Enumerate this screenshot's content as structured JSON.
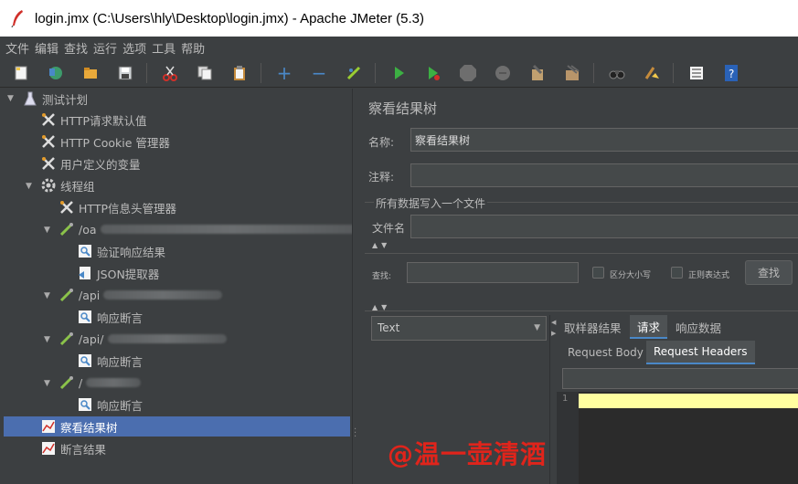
{
  "window": {
    "title": "login.jmx (C:\\Users\\hly\\Desktop\\login.jmx) - Apache JMeter (5.3)"
  },
  "menu": [
    "文件",
    "编辑",
    "查找",
    "运行",
    "选项",
    "工具",
    "帮助"
  ],
  "toolbar": {
    "icons": [
      "new-icon",
      "templates-icon",
      "open-icon",
      "save-icon",
      "cut-icon",
      "copy-icon",
      "paste-icon",
      "expand-icon",
      "collapse-icon",
      "toggle-icon",
      "start-icon",
      "start-no-pause-icon",
      "stop-icon",
      "shutdown-icon",
      "clear-icon",
      "clear-all-icon",
      "search-icon",
      "reset-search-icon",
      "function-helper-icon",
      "help-icon"
    ]
  },
  "tree": {
    "root": "测试计划",
    "http_defaults": "HTTP请求默认值",
    "cookie_manager": "HTTP Cookie 管理器",
    "user_vars": "用户定义的变量",
    "thread_group": "线程组",
    "header_manager": "HTTP信息头管理器",
    "sampler1": "/oa",
    "assertion1": "验证响应结果",
    "json_extractor": "JSON提取器",
    "sampler2": "/api",
    "assertion2": "响应断言",
    "sampler3": "/api/",
    "assertion3": "响应断言",
    "sampler4": "/",
    "assertion4": "响应断言",
    "result_tree": "察看结果树",
    "assert_results": "断言结果"
  },
  "panel": {
    "title": "察看结果树",
    "name_label": "名称:",
    "name_value": "察看结果树",
    "comment_label": "注释:",
    "comment_value": "",
    "file_section": "所有数据写入一个文件",
    "filename_label": "文件名",
    "search_label": "查找:",
    "case_label": "区分大小写",
    "regex_label": "正则表达式",
    "search_button": "查找",
    "renderer": "Text",
    "tabs": [
      "取样器结果",
      "请求",
      "响应数据"
    ],
    "subtabs": [
      "Request Body",
      "Request Headers"
    ],
    "line_number": "1"
  },
  "watermark": "@温一壶清酒",
  "colors": {
    "selected": "#4b6eaf",
    "accent_tab": "#4a88c7",
    "editor_line": "#ffffa0",
    "watermark": "#e0241b"
  }
}
